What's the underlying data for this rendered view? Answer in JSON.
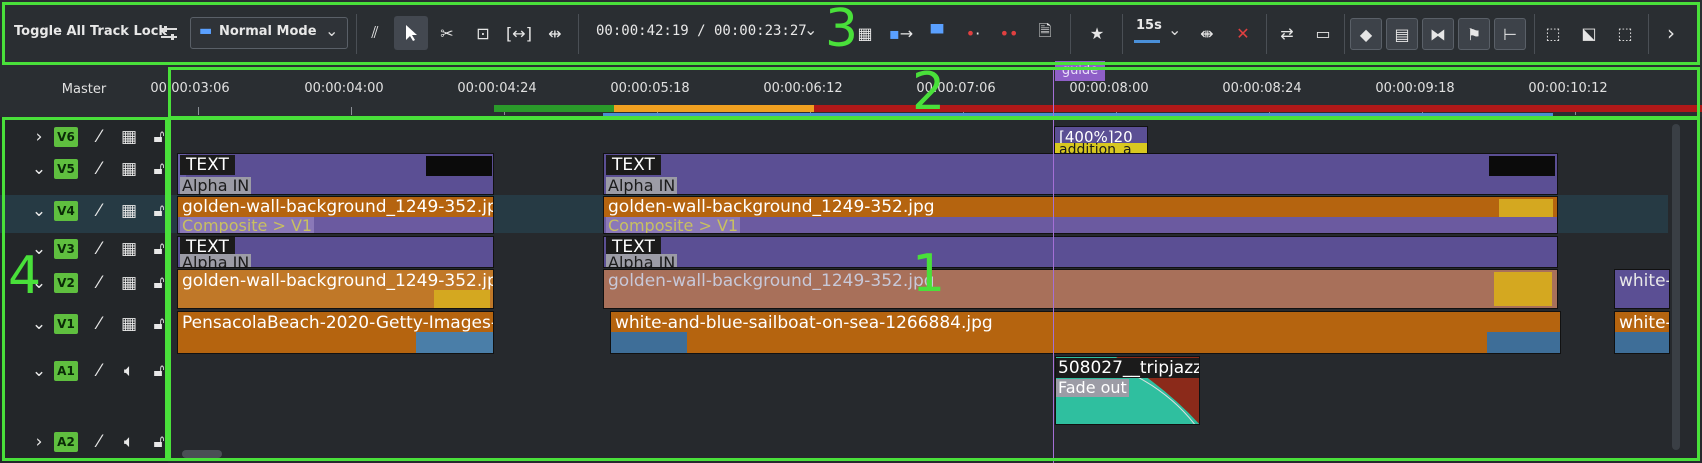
{
  "toolbar": {
    "toggle_lock_label": "Toggle All Track Lock",
    "mode_select": "Normal Mode",
    "timecode": "00:00:42:19 / 00:00:23:27",
    "zoom_value": "15s",
    "icons": [
      "settings-sliders-icon",
      "mode-icon",
      "snap-icon",
      "select-icon",
      "razor-icon",
      "spacer-icon",
      "ripple-icon",
      "slip-icon",
      "insert-icon",
      "overwrite-icon",
      "lift-icon",
      "extract-icon",
      "remove-space-icon",
      "render-icon",
      "favorite-icon",
      "zoom-fit-icon",
      "zoom-out-icon",
      "zoom-in-icon",
      "mixer-icon",
      "subtitle-icon",
      "tag-icon",
      "film-icon",
      "audio-icon",
      "flag-icon",
      "split-icon",
      "select-all-icon",
      "select-region-icon",
      "select-clip-icon",
      "chevron-right-icon"
    ]
  },
  "annotations": {
    "n1": "1",
    "n2": "2",
    "n3": "3",
    "n4": "4"
  },
  "master_label": "Master",
  "ruler": {
    "labels": [
      "00:00:03:06",
      "00:00:04:00",
      "00:00:04:24",
      "00:00:05:18",
      "00:00:06:12",
      "00:00:07:06",
      "00:00:08:00",
      "00:00:08:24",
      "00:00:09:18",
      "00:00:10:12"
    ],
    "guide_label": "guide"
  },
  "tracks": [
    {
      "name": "V6",
      "type": "video",
      "expanded": false
    },
    {
      "name": "V5",
      "type": "video",
      "expanded": true
    },
    {
      "name": "V4",
      "type": "video",
      "expanded": true
    },
    {
      "name": "V3",
      "type": "video",
      "expanded": true
    },
    {
      "name": "V2",
      "type": "video",
      "expanded": true
    },
    {
      "name": "V1",
      "type": "video",
      "expanded": true
    },
    {
      "name": "A1",
      "type": "audio",
      "expanded": true
    },
    {
      "name": "A2",
      "type": "audio",
      "expanded": false
    }
  ],
  "clips": {
    "v6_label": "[400%]20",
    "v6_sub": "addition_a",
    "text_label": "TEXT",
    "alpha_label": "Alpha IN",
    "gold_label": "golden-wall-background_1249-352.jpg",
    "composite_label": "Composite > V1",
    "beach_label": "PensacolaBeach-2020-Getty-Images-",
    "sailboat_label": "white-and-blue-sailboat-on-sea-1266884.jpg",
    "white_short": "white-",
    "audio_label": "508027__tripjazz",
    "fade_label": "Fade out"
  },
  "colors": {
    "accent_green": "#49e03a",
    "track_badge": "#5fbf3f",
    "clip_purple": "#5b4f94",
    "clip_orange": "#b5640f",
    "clip_teal": "#2fbf9f",
    "playhead": "#a46fd6"
  }
}
